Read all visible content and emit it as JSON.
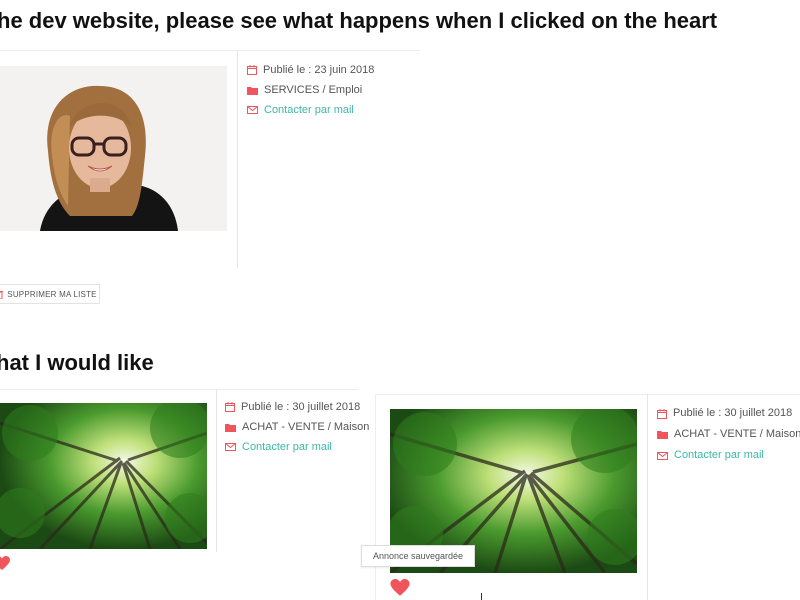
{
  "headings": {
    "top": "he dev website, please see what happens when I clicked on the heart",
    "bottom": "hat I would like"
  },
  "listing_dev": {
    "published": "Publié le : 23 juin 2018",
    "category": "SERVICES / Emploi",
    "contact": "Contacter par mail",
    "delete_label": "SUPPRIMER MA LISTE"
  },
  "listing_like_1": {
    "published": "Publié le : 30 juillet 2018",
    "category": "ACHAT - VENTE / Maison",
    "contact": "Contacter par mail"
  },
  "listing_like_2": {
    "published": "Publié le : 30 juillet 2018",
    "category": "ACHAT - VENTE / Maison",
    "contact": "Contacter par mail",
    "tooltip": "Annonce sauvegardée"
  },
  "colors": {
    "accent_red": "#f0555c",
    "link_teal": "#3fb6a8",
    "forest_green": "#3e8a2a"
  },
  "icons": [
    "calendar-icon",
    "folder-icon",
    "envelope-icon",
    "trash-icon",
    "heart-icon"
  ]
}
